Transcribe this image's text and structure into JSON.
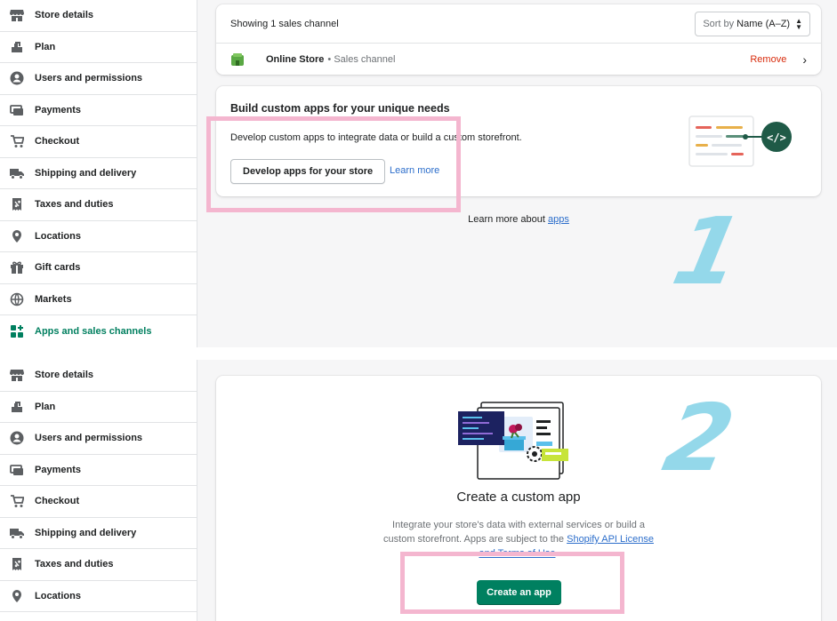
{
  "sidebar_top": [
    {
      "label": "Store details",
      "icon": "store-icon"
    },
    {
      "label": "Plan",
      "icon": "plan-icon"
    },
    {
      "label": "Users and permissions",
      "icon": "user-icon"
    },
    {
      "label": "Payments",
      "icon": "payments-icon"
    },
    {
      "label": "Checkout",
      "icon": "cart-icon"
    },
    {
      "label": "Shipping and delivery",
      "icon": "truck-icon"
    },
    {
      "label": "Taxes and duties",
      "icon": "receipt-icon"
    },
    {
      "label": "Locations",
      "icon": "location-icon"
    },
    {
      "label": "Gift cards",
      "icon": "gift-icon"
    },
    {
      "label": "Markets",
      "icon": "globe-icon"
    },
    {
      "label": "Apps and sales channels",
      "icon": "apps-icon",
      "active": true
    }
  ],
  "sidebar_bottom": [
    {
      "label": "Store details",
      "icon": "store-icon"
    },
    {
      "label": "Plan",
      "icon": "plan-icon"
    },
    {
      "label": "Users and permissions",
      "icon": "user-icon"
    },
    {
      "label": "Payments",
      "icon": "payments-icon"
    },
    {
      "label": "Checkout",
      "icon": "cart-icon"
    },
    {
      "label": "Shipping and delivery",
      "icon": "truck-icon"
    },
    {
      "label": "Taxes and duties",
      "icon": "receipt-icon"
    },
    {
      "label": "Locations",
      "icon": "location-icon"
    }
  ],
  "channels": {
    "showing": "Showing 1 sales channel",
    "sort_prefix": "Sort by",
    "sort_value": "Name (A–Z)",
    "row": {
      "name": "Online Store",
      "sub": "• Sales channel",
      "remove": "Remove"
    }
  },
  "build": {
    "title": "Build custom apps for your unique needs",
    "desc": "Develop custom apps to integrate data or build a custom storefront.",
    "button": "Develop apps for your store",
    "link": "Learn more"
  },
  "learn_more": {
    "text": "Learn more about ",
    "link": "apps"
  },
  "steps": {
    "one": "1",
    "two": "2"
  },
  "custom": {
    "title": "Create a custom app",
    "desc": "Integrate your store's data with external services or build a custom storefront. Apps are subject to the ",
    "desc_link": "Shopify API License and Terms of Use",
    "desc_end": ".",
    "button": "Create an app"
  },
  "colors": {
    "accent": "#008060",
    "highlight": "#f4b6cf",
    "step": "#94d8ea",
    "danger": "#d82c0d",
    "link": "#2c6ecb"
  }
}
